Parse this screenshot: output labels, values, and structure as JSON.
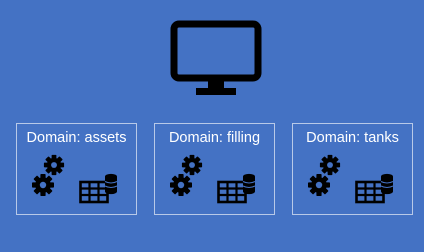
{
  "diagram": {
    "background_color": "#4472c4",
    "icon_color": "#000000",
    "top_icon": "monitor-icon",
    "domains": [
      {
        "label": "Domain: assets",
        "icons": [
          "gears-icon",
          "database-grid-icon"
        ]
      },
      {
        "label": "Domain: filling",
        "icons": [
          "gears-icon",
          "database-grid-icon"
        ]
      },
      {
        "label": "Domain: tanks",
        "icons": [
          "gears-icon",
          "database-grid-icon"
        ]
      }
    ]
  }
}
